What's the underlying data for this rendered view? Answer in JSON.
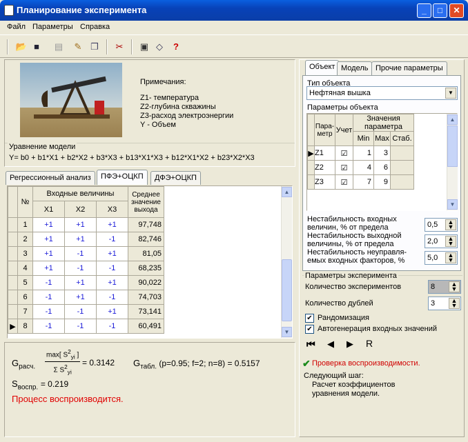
{
  "window": {
    "title": "Планирование эксперимента",
    "min": "_",
    "max": "□",
    "close": "✕"
  },
  "menu": [
    "Файл",
    "Параметры",
    "Справка"
  ],
  "notes": {
    "title": "Примечания:",
    "lines": [
      "Z1- температура",
      "Z2-глубина скважины",
      "Z3-расход электроэнергии",
      "Y - Объем"
    ]
  },
  "model_eq": {
    "label": "Уравнение модели",
    "text": "Y= b0 + b1*X1 + b2*X2 + b3*X3 + b13*X1*X3 + b12*X1*X2 + b23*X2*X3"
  },
  "left_tabs": [
    "Регрессионный анализ",
    "ПФЭ+ОЦКП",
    "ДФЭ+ОЦКП"
  ],
  "table": {
    "col_n": "№",
    "col_inputs": "Входные величины",
    "cols": [
      "X1",
      "X2",
      "X3"
    ],
    "col_avg": "Среднее значение выхода",
    "rows": [
      {
        "n": "1",
        "x1": "+1",
        "x2": "+1",
        "x3": "+1",
        "y": "97,748"
      },
      {
        "n": "2",
        "x1": "+1",
        "x2": "+1",
        "x3": "-1",
        "y": "82,746"
      },
      {
        "n": "3",
        "x1": "+1",
        "x2": "-1",
        "x3": "+1",
        "y": "81,05"
      },
      {
        "n": "4",
        "x1": "+1",
        "x2": "-1",
        "x3": "-1",
        "y": "68,235"
      },
      {
        "n": "5",
        "x1": "-1",
        "x2": "+1",
        "x3": "+1",
        "y": "90,022"
      },
      {
        "n": "6",
        "x1": "-1",
        "x2": "+1",
        "x3": "-1",
        "y": "74,703"
      },
      {
        "n": "7",
        "x1": "-1",
        "x2": "-1",
        "x3": "+1",
        "y": "73,141"
      },
      {
        "n": "8",
        "x1": "-1",
        "x2": "-1",
        "x3": "-1",
        "y": "60,491"
      }
    ]
  },
  "results": {
    "g_label": "G",
    "g_sub": "расч.",
    "g_frac_top": "max[ S",
    "g_frac_bottom": "Σ S",
    "g_value": "= 0.3142",
    "gt_label": "G",
    "gt_sub": "табл.",
    "gt_text": "(p=0.95; f=2; n=8) = 0.5157",
    "s_label": "S",
    "s_sub": "воспр.",
    "s_value": "= 0.219",
    "status": "Процесс воспроизводится."
  },
  "right_tabs": [
    "Объект",
    "Модель",
    "Прочие параметры"
  ],
  "object_type": {
    "label": "Тип объекта",
    "value": "Нефтяная вышка"
  },
  "params": {
    "label": "Параметры объекта",
    "h_param": "Пара-метр",
    "h_use": "Учет",
    "h_values": "Значения параметра",
    "h_min": "Min",
    "h_max": "Max",
    "h_stab": "Стаб.",
    "rows": [
      {
        "name": "Z1",
        "min": "1",
        "max": "3"
      },
      {
        "name": "Z2",
        "min": "4",
        "max": "6"
      },
      {
        "name": "Z3",
        "min": "7",
        "max": "9"
      }
    ]
  },
  "instab": [
    {
      "label": "Нестабильность входных величин, % от предела",
      "value": "0,5"
    },
    {
      "label": "Нестабильность выходной величины, % от предела",
      "value": "2,0"
    },
    {
      "label": "Нестабильность неуправля-емых входных факторов, %",
      "value": "5,0"
    }
  ],
  "experiment": {
    "label": "Параметры эксперимента",
    "count_label": "Количество экспериментов",
    "count": "8",
    "dup_label": "Количество дублей",
    "dup": "3",
    "random": "Рандомизация",
    "autogen": "Автогенерация входных значений"
  },
  "nav": {
    "first": "⏮",
    "prev": "◀",
    "next": "▶",
    "reset": "R"
  },
  "check": {
    "text": "Проверка воспроизводимости.",
    "next_label": "Следующий шаг:",
    "next_text": "Расчет коэффициентов уравнения модели."
  }
}
